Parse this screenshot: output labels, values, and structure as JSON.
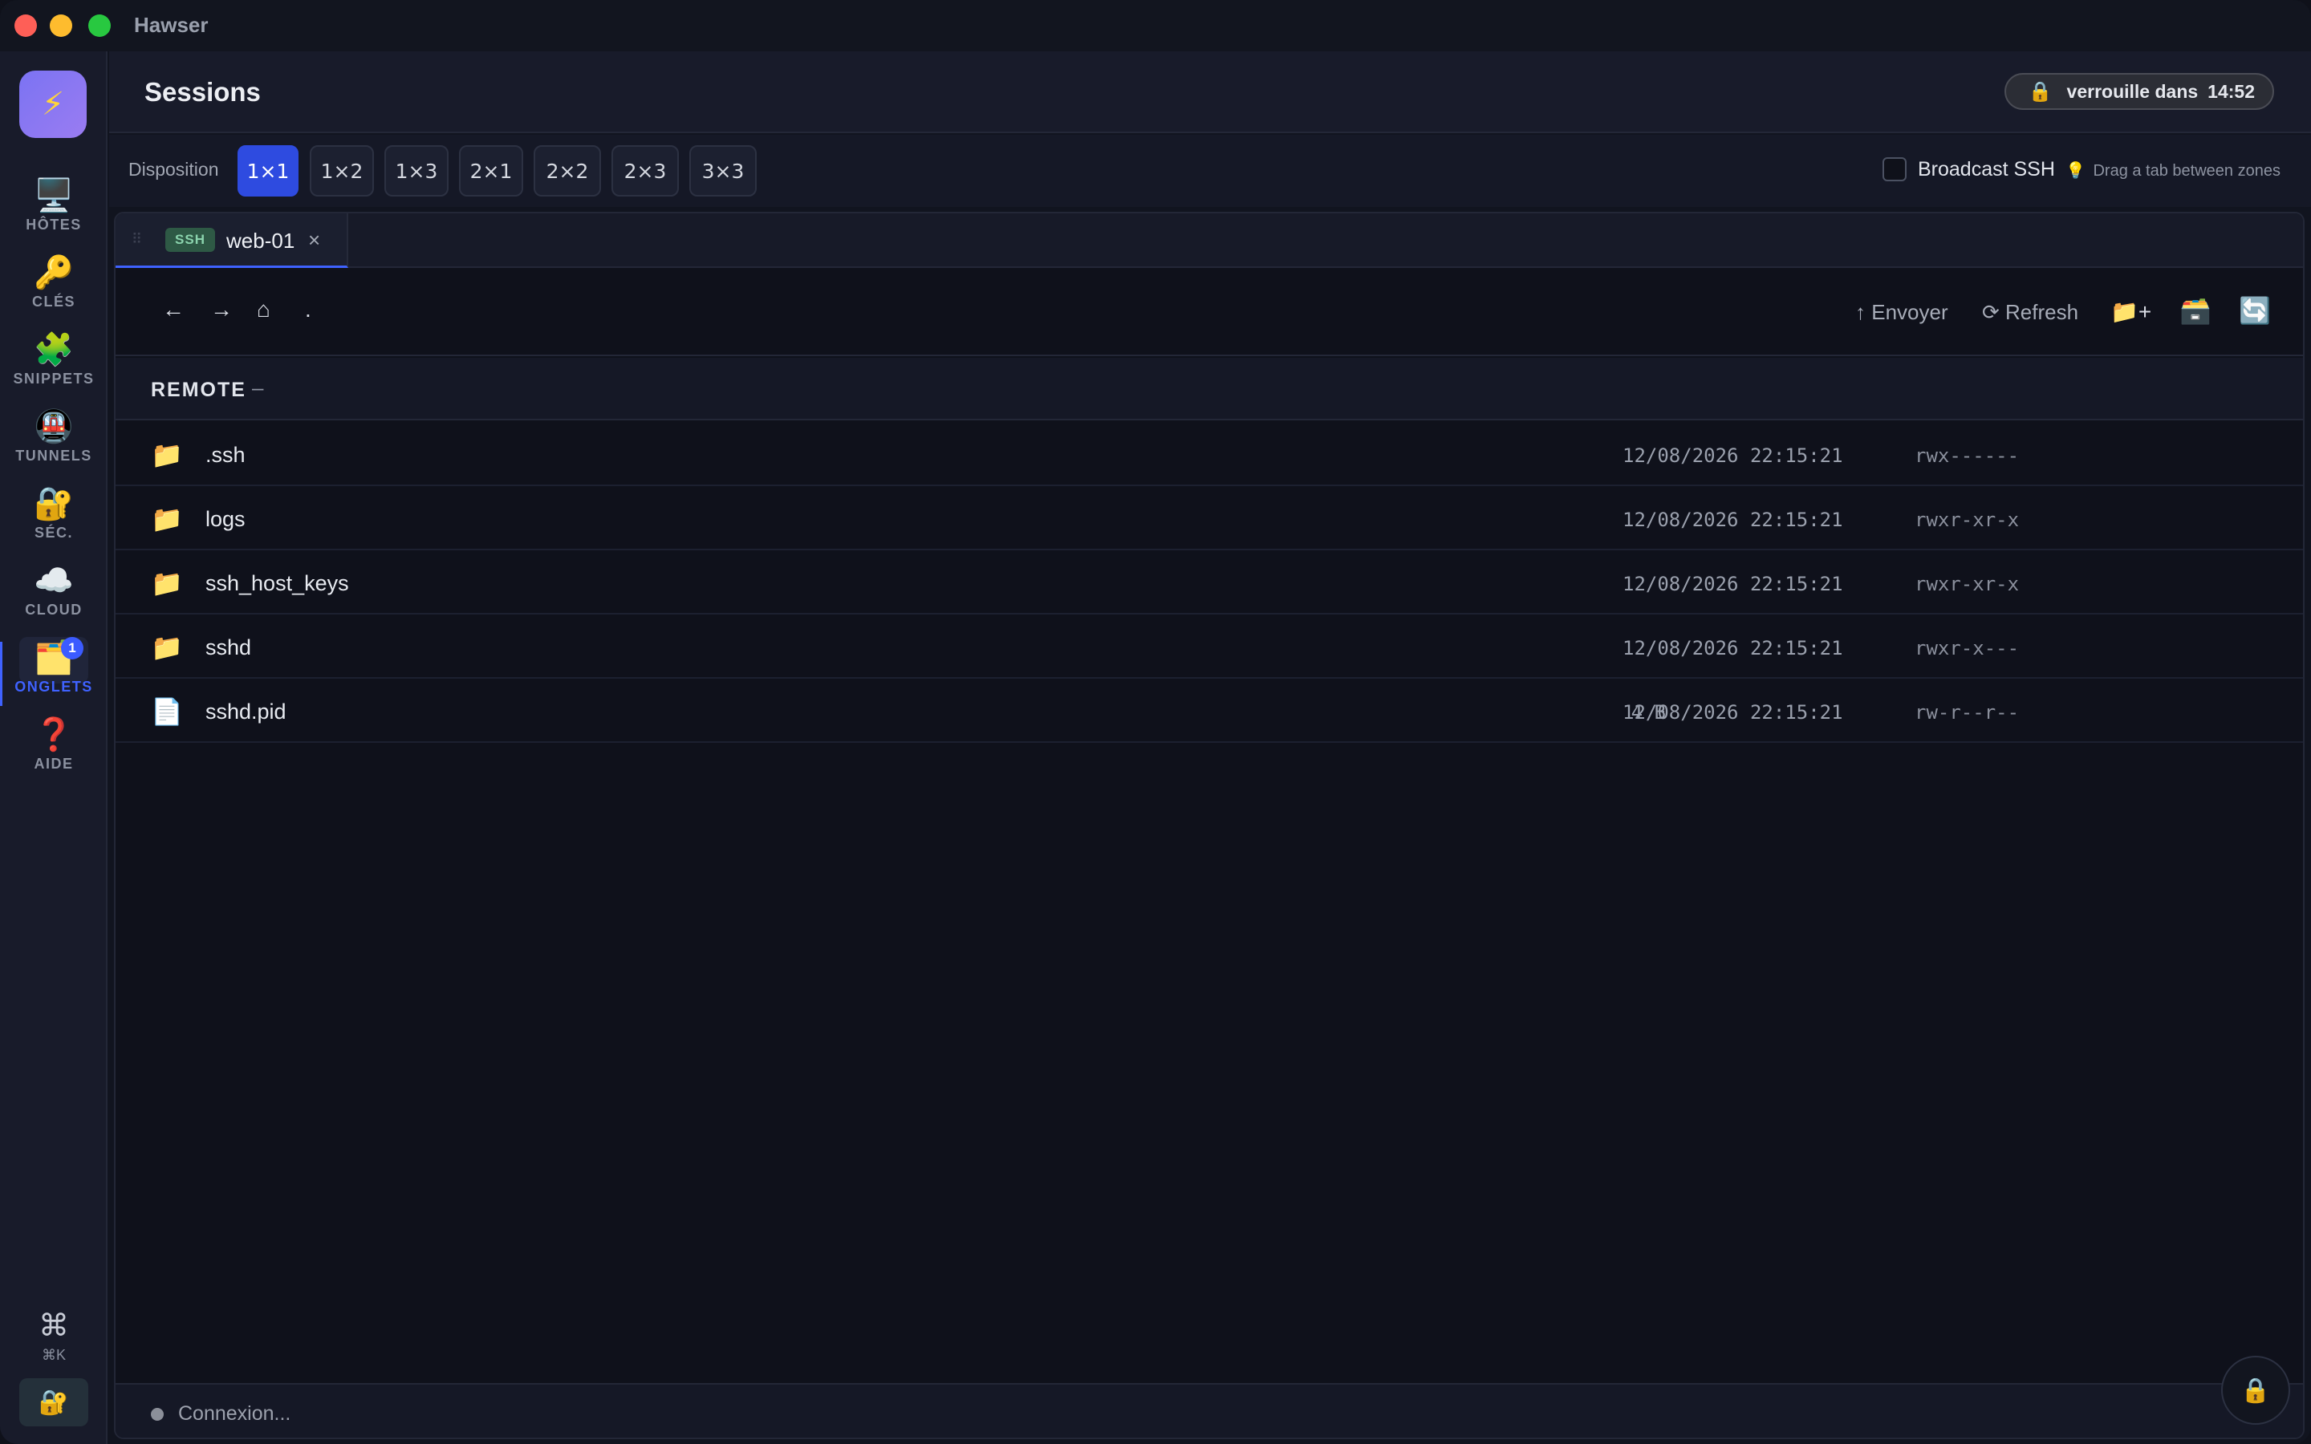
{
  "app": {
    "title": "Hawser"
  },
  "sidebar": {
    "logo_icon": "⚡",
    "items": [
      {
        "key": "hotes",
        "icon": "🖥️",
        "label": "HÔTES"
      },
      {
        "key": "cles",
        "icon": "🔑",
        "label": "CLÉS"
      },
      {
        "key": "snippets",
        "icon": "🧩",
        "label": "SNIPPETS"
      },
      {
        "key": "tunnels",
        "icon": "🚇",
        "label": "TUNNELS"
      },
      {
        "key": "sec",
        "icon": "🔐",
        "label": "SÉC."
      },
      {
        "key": "cloud",
        "icon": "☁️",
        "label": "CLOUD"
      },
      {
        "key": "onglets",
        "icon": "🗂️",
        "label": "ONGLETS",
        "badge": "1",
        "active": true
      },
      {
        "key": "aide",
        "icon": "❓",
        "label": "AIDE"
      }
    ],
    "cmdk": {
      "symbol": "⌘",
      "label": "⌘K"
    },
    "lock_icon": "🔐"
  },
  "header": {
    "title": "Sessions",
    "lock_pill": {
      "icon": "🔒",
      "text": "verrouille dans",
      "time": "14:52"
    }
  },
  "layoutbar": {
    "label": "Disposition",
    "options": [
      "1×1",
      "1×2",
      "1×3",
      "2×1",
      "2×2",
      "2×3",
      "3×3"
    ],
    "selected": "1×1",
    "broadcast_label": "Broadcast SSH",
    "broadcast_checked": false,
    "hint_icon": "💡",
    "hint": "Drag a tab between zones"
  },
  "session_tab": {
    "grip": "⠿",
    "badge": "SSH",
    "name": "web-01",
    "close": "×"
  },
  "filebar": {
    "back": "←",
    "forward": "→",
    "home": "⌂",
    "path": ".",
    "upload_label": "↑ Envoyer",
    "refresh_label": "⟳ Refresh",
    "new_folder_icon": "📁+",
    "open_icon": "🗃️",
    "sync_icon": "🔄"
  },
  "remote": {
    "label": "REMOTE",
    "collapse": "–",
    "files": [
      {
        "icon": "📁",
        "name": ".ssh",
        "size": "",
        "date": "12/08/2026 22:15:21",
        "perm": "rwx------"
      },
      {
        "icon": "📁",
        "name": "logs",
        "size": "",
        "date": "12/08/2026 22:15:21",
        "perm": "rwxr-xr-x"
      },
      {
        "icon": "📁",
        "name": "ssh_host_keys",
        "size": "",
        "date": "12/08/2026 22:15:21",
        "perm": "rwxr-xr-x"
      },
      {
        "icon": "📁",
        "name": "sshd",
        "size": "",
        "date": "12/08/2026 22:15:21",
        "perm": "rwxr-x---"
      },
      {
        "icon": "📄",
        "name": "sshd.pid",
        "size": "4 B",
        "date": "12/08/2026 22:15:21",
        "perm": "rw-r--r--"
      }
    ]
  },
  "status": {
    "text": "Connexion..."
  },
  "float_lock_icon": "🔒",
  "colors": {
    "accent": "#3f62ff",
    "active_layout": "#2e4be0",
    "ssh_badge": "#2e5945"
  }
}
